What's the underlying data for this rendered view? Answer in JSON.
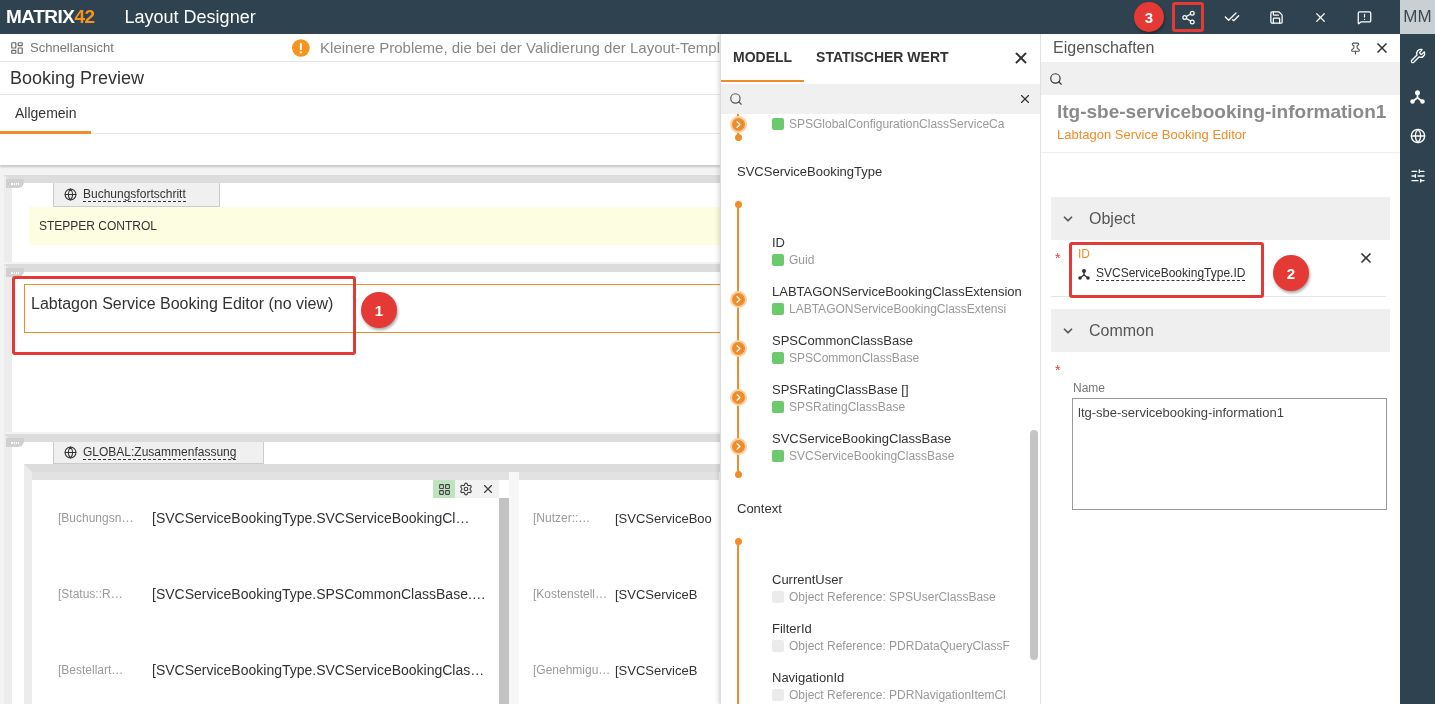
{
  "top_bar": {
    "logo": {
      "text": "MATRIX",
      "accent": "42"
    },
    "title": "Layout Designer",
    "actions": [
      {
        "kind": "share",
        "highlighted": true,
        "callout": "3"
      },
      {
        "kind": "validate",
        "highlighted": false
      },
      {
        "kind": "save",
        "highlighted": false
      },
      {
        "kind": "close",
        "highlighted": false
      },
      {
        "kind": "feedback",
        "highlighted": false
      }
    ]
  },
  "canvas": {
    "quick_view": "Schnellansicht",
    "warning": "Kleinere Probleme, die bei der Validierung der Layout-Templ",
    "title": "Booking Preview",
    "tabs": [
      {
        "label": "Allgemein",
        "selected": true
      }
    ],
    "stepper": {
      "tab": "Buchungsfortschritt",
      "text": "STEPPER CONTROL"
    },
    "editor": {
      "text": "Labtagon Service Booking Editor (no view)",
      "highlighted": true,
      "callout": "1"
    },
    "summary": {
      "tab_prefix": "GLOBAL:",
      "tab": "Zusammenfassung",
      "panels": [
        {
          "selected": true,
          "rows": [
            {
              "label": "[Buchungsn…",
              "value": "[SVCServiceBookingType.SVCServiceBookingCl…"
            },
            {
              "label": "[Status::R…",
              "value": "[SVCServiceBookingType.SPSCommonClassBase.…"
            },
            {
              "label": "[Bestellart…",
              "value": "[SVCServiceBookingType.SVCServiceBookingClas…"
            }
          ]
        },
        {
          "selected": false,
          "rows": [
            {
              "label": "[Nutzer::…",
              "value": "[SVCServiceBoo"
            },
            {
              "label": "[Kostenstell…",
              "value": "[SVCServiceB"
            },
            {
              "label": "[Genehmigu…",
              "value": "[SVCServiceB"
            }
          ]
        }
      ]
    }
  },
  "model_panel": {
    "tabs": [
      {
        "label": "MODELL",
        "selected": true
      },
      {
        "label": "STATISCHER WERT",
        "selected": false
      }
    ],
    "tree": [
      {
        "items": [
          {
            "type": "SPSGlobalConfigurationClassServiceCa",
            "color": "#6cc96c",
            "expandable": true
          }
        ]
      },
      {
        "title": "SVCServiceBookingType",
        "items": [
          {
            "name": "ID",
            "type": "Guid",
            "color": "#6cc96c",
            "expandable": false
          },
          {
            "name": "LABTAGONServiceBookingClassExtension",
            "type": "LABTAGONServiceBookingClassExtensi",
            "color": "#6cc96c",
            "expandable": true
          },
          {
            "name": "SPSCommonClassBase",
            "type": "SPSCommonClassBase",
            "color": "#6cc96c",
            "expandable": true
          },
          {
            "name": "SPSRatingClassBase []",
            "type": "SPSRatingClassBase",
            "color": "#6cc96c",
            "expandable": true
          },
          {
            "name": "SVCServiceBookingClassBase",
            "type": "SVCServiceBookingClassBase",
            "color": "#6cc96c",
            "expandable": true
          }
        ]
      },
      {
        "title": "Context",
        "items": [
          {
            "name": "CurrentUser",
            "type": "Object Reference: SPSUserClassBase",
            "color": "#ebebeb",
            "expandable": false
          },
          {
            "name": "FilterId",
            "type": "Object Reference: PDRDataQueryClassF",
            "color": "#ebebeb",
            "expandable": false
          },
          {
            "name": "NavigationId",
            "type": "Object Reference: PDRNavigationItemCl",
            "color": "#ebebeb",
            "expandable": false
          }
        ]
      }
    ]
  },
  "properties": {
    "title": "Eigenschaften",
    "heading": "ltg-sbe-servicebooking-information1",
    "subtitle": "Labtagon Service Booking Editor",
    "sections": [
      {
        "kind": "binding",
        "title": "Object",
        "expanded": true,
        "field": {
          "label": "ID",
          "value": "SVCServiceBookingType.ID",
          "required_mark": "*",
          "highlighted": true,
          "callout": "2"
        }
      },
      {
        "kind": "text",
        "title": "Common",
        "expanded": true,
        "field": {
          "label": "Name",
          "value": "ltg-sbe-servicebooking-information1",
          "required_mark": "*"
        }
      }
    ]
  },
  "rail": {
    "user": "MM",
    "items": [
      {
        "kind": "tools"
      },
      {
        "kind": "hierarchy"
      },
      {
        "kind": "globe"
      },
      {
        "kind": "sliders"
      }
    ]
  }
}
